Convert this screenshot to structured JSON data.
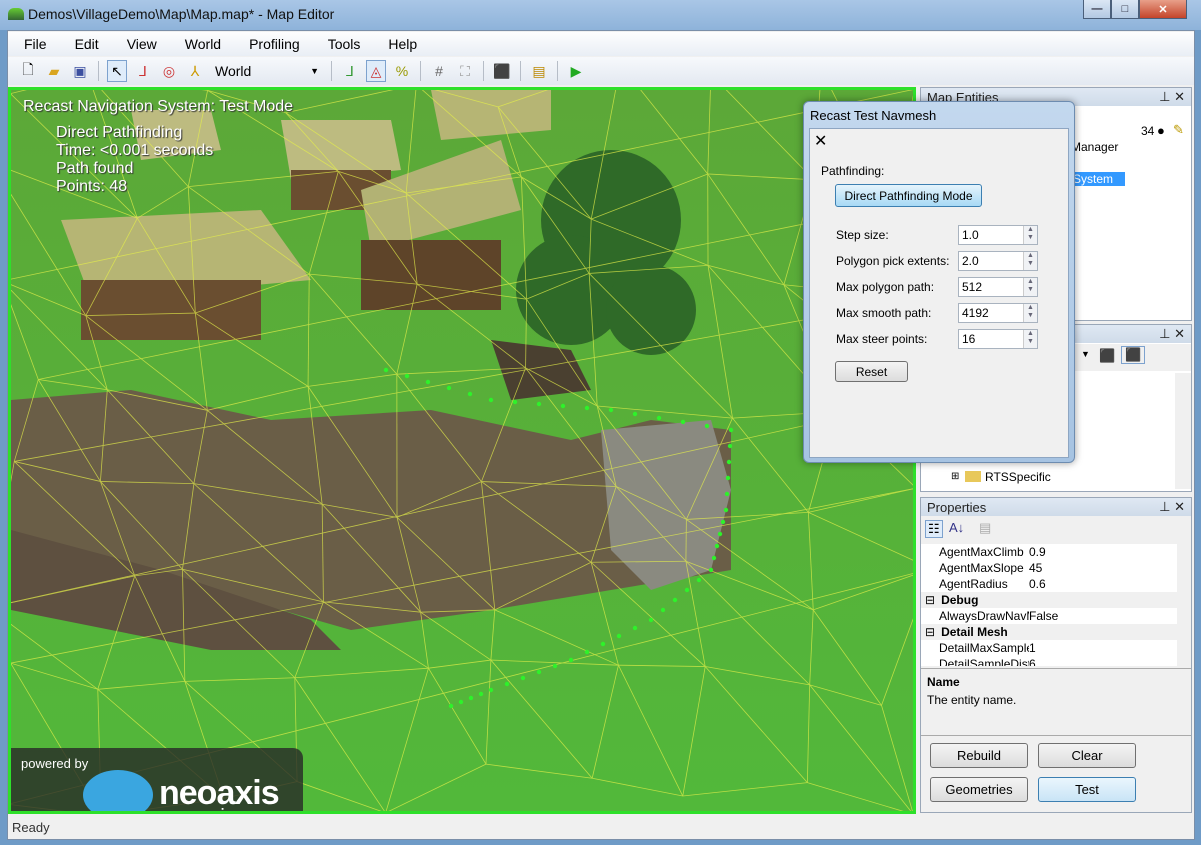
{
  "window": {
    "title": "Demos\\VillageDemo\\Map\\Map.map* - Map Editor",
    "min": "—",
    "max": "□",
    "close": "✕"
  },
  "menu": [
    "File",
    "Edit",
    "View",
    "World",
    "Profiling",
    "Tools",
    "Help"
  ],
  "toolbar": {
    "coord_system": "World",
    "icons": [
      "new-icon",
      "open-icon",
      "save-icon",
      "select-icon",
      "move-icon",
      "rotate-icon",
      "scale-icon",
      "snap-icon",
      "navmesh-icon",
      "percent-icon",
      "grid-icon",
      "frame-icon",
      "entity-icon",
      "properties-icon",
      "play-icon"
    ]
  },
  "viewport": {
    "overlay_title": "Recast Navigation System: Test Mode",
    "overlay_lines": [
      "Direct Pathfinding",
      "Time: <0.001 seconds",
      "Path found",
      "Points: 48"
    ],
    "logo": {
      "top": "powered by",
      "brand": "neoaxis",
      "sub": "engine"
    }
  },
  "status": "Ready",
  "map_entities": {
    "title": "Map Entities",
    "count": "34",
    "items": [
      "Manager",
      "System"
    ]
  },
  "resources_panel": {
    "tree": [
      "RTSSpecific"
    ]
  },
  "properties": {
    "title": "Properties",
    "rows": [
      {
        "type": "prop",
        "name": "AgentMaxClimb",
        "value": "0.9"
      },
      {
        "type": "prop",
        "name": "AgentMaxSlope",
        "value": "45"
      },
      {
        "type": "prop",
        "name": "AgentRadius",
        "value": "0.6"
      },
      {
        "type": "cat",
        "name": "Debug"
      },
      {
        "type": "prop",
        "name": "AlwaysDrawNavMe",
        "value": "False"
      },
      {
        "type": "cat",
        "name": "Detail Mesh"
      },
      {
        "type": "prop",
        "name": "DetailMaxSampleE",
        "value": "1"
      },
      {
        "type": "prop",
        "name": "DetailSampleDista",
        "value": "6"
      }
    ],
    "desc_title": "Name",
    "desc_text": "The entity name."
  },
  "actions": {
    "rebuild": "Rebuild",
    "clear": "Clear",
    "geometries": "Geometries",
    "test": "Test"
  },
  "dialog": {
    "title": "Recast Test Navmesh",
    "close": "✕",
    "section": "Pathfinding:",
    "mode_button": "Direct Pathfinding Mode",
    "fields": [
      {
        "label": "Step size:",
        "value": "1.0"
      },
      {
        "label": "Polygon pick extents:",
        "value": "2.0"
      },
      {
        "label": "Max polygon path:",
        "value": "512"
      },
      {
        "label": "Max smooth path:",
        "value": "4192"
      },
      {
        "label": "Max steer points:",
        "value": "16"
      }
    ],
    "reset": "Reset"
  },
  "colors": {
    "navmesh": "#3bd42f",
    "border": "#2ee02a",
    "selection": "#3399ff"
  }
}
